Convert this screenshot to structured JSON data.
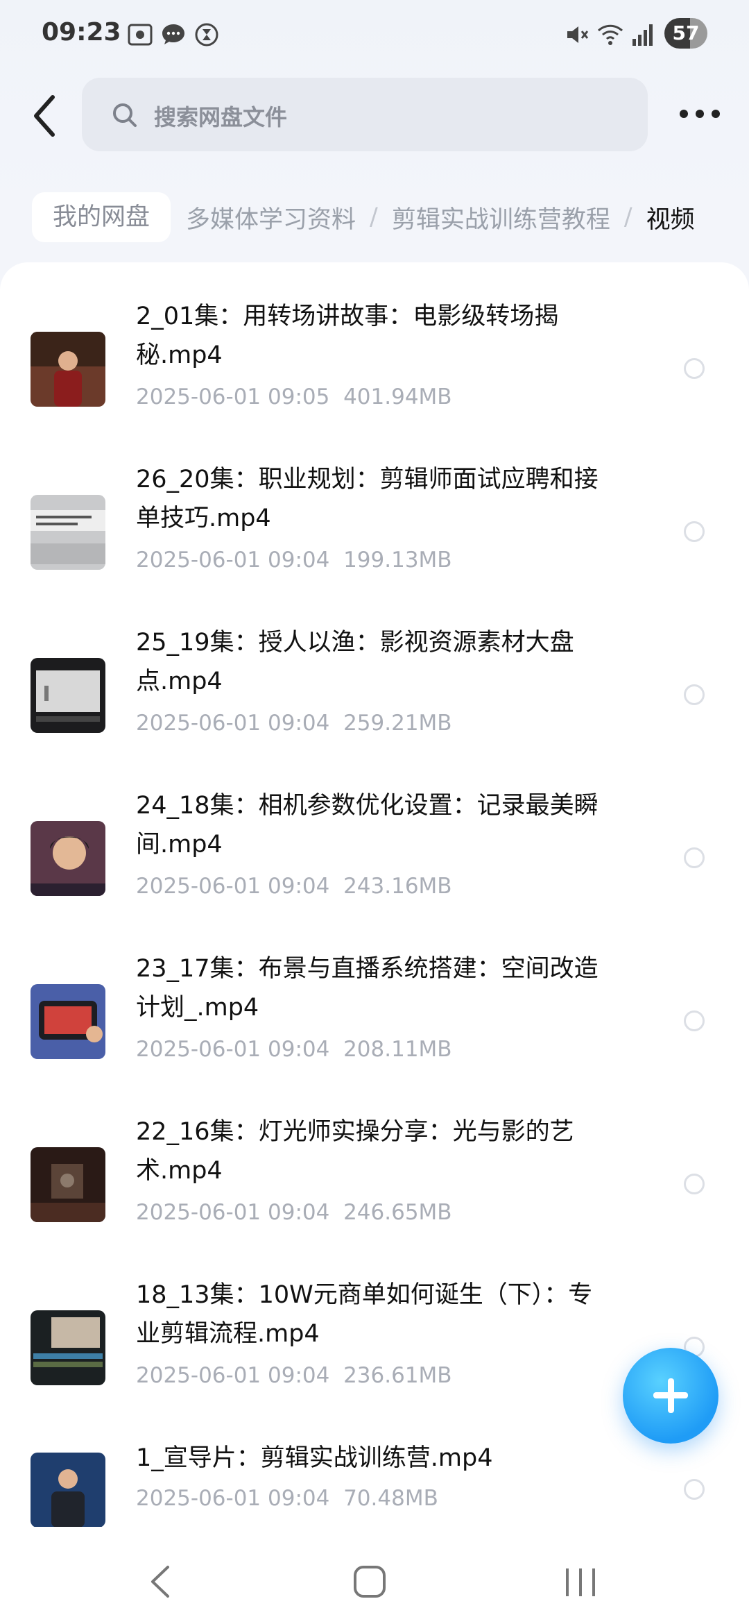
{
  "status_bar": {
    "time": "09:23",
    "battery": "57",
    "left_icons": [
      "screenshot-icon",
      "message-icon",
      "timer-icon"
    ],
    "right_icons": [
      "mute-icon",
      "wifi-icon",
      "signal-icon"
    ]
  },
  "header": {
    "search_placeholder": "搜索网盘文件"
  },
  "breadcrumb": {
    "root": "我的网盘",
    "levels": [
      "多媒体学习资料",
      "剪辑实战训练营教程"
    ],
    "current": "视频",
    "separator": "/"
  },
  "files": [
    {
      "name_line1": "2_01集：用转场讲故事：电影级转场揭",
      "name_line2": "秘.mp4",
      "date": "2025-06-01  09:05",
      "size": "401.94MB"
    },
    {
      "name_line1": "26_20集：职业规划：剪辑师面试应聘和接",
      "name_line2": "单技巧.mp4",
      "date": "2025-06-01  09:04",
      "size": "199.13MB"
    },
    {
      "name_line1": "25_19集：授人以渔：影视资源素材大盘",
      "name_line2": "点.mp4",
      "date": "2025-06-01  09:04",
      "size": "259.21MB"
    },
    {
      "name_line1": "24_18集：相机参数优化设置：记录最美瞬",
      "name_line2": "间.mp4",
      "date": "2025-06-01  09:04",
      "size": "243.16MB"
    },
    {
      "name_line1": "23_17集：布景与直播系统搭建：空间改造",
      "name_line2": "计划_.mp4",
      "date": "2025-06-01  09:04",
      "size": "208.11MB"
    },
    {
      "name_line1": "22_16集：灯光师实操分享：光与影的艺",
      "name_line2": "术.mp4",
      "date": "2025-06-01  09:04",
      "size": "246.65MB"
    },
    {
      "name_line1": "18_13集：10W元商单如何诞生（下）：专",
      "name_line2": "业剪辑流程.mp4",
      "date": "2025-06-01  09:04",
      "size": "236.61MB"
    },
    {
      "name_line1": "1_宣导片：剪辑实战训练营.mp4",
      "name_line2": "",
      "date": "2025-06-01  09:04",
      "size": "70.48MB"
    }
  ],
  "colors": {
    "accent": "#1f9cf6",
    "meta_text": "#a9adb6",
    "background": "#f3f5fa"
  }
}
